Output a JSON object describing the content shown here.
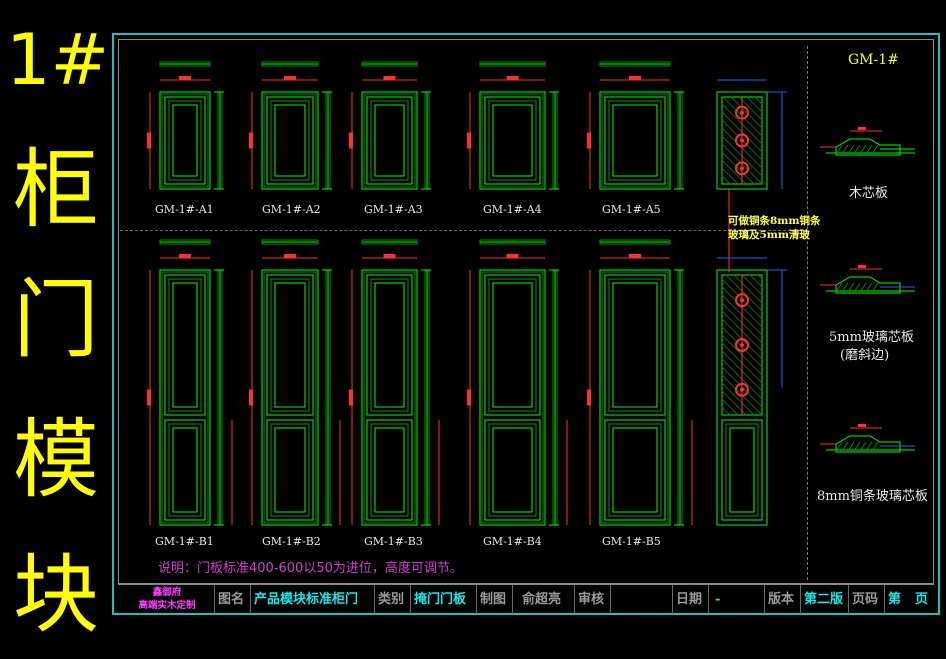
{
  "sidebar_title": [
    "1#",
    "柜",
    "门",
    "模",
    "块"
  ],
  "header": {
    "code": "GM-1#"
  },
  "doors_top": [
    "GM-1#-A1",
    "GM-1#-A2",
    "GM-1#-A3",
    "GM-1#-A4",
    "GM-1#-A5"
  ],
  "doors_bottom": [
    "GM-1#-B1",
    "GM-1#-B2",
    "GM-1#-B3",
    "GM-1#-B4",
    "GM-1#-B5"
  ],
  "glass_note": [
    "可做铜条8mm铜条",
    "玻璃及5mm清玻"
  ],
  "profiles": {
    "p1": "木芯板",
    "p2_line1": "5mm玻璃芯板",
    "p2_line2": "(磨斜边)",
    "p3": "8mm铜条玻璃芯板"
  },
  "note": "说明：门板标准400-600以50为进位，高度可调节。",
  "title_block": {
    "logo_line1": "鑫御府",
    "logo_line2": "高端实木定制",
    "name_label": "图名",
    "name_value": "产品模块标准柜门",
    "category_label": "类别",
    "category_value": "掩门门板",
    "drawn_label": "制图",
    "drawn_value": "俞超亮",
    "review_label": "审核",
    "date_label": "日期",
    "date_value": "-",
    "version_label": "版本",
    "version_value": "第二版",
    "page_label": "页码",
    "page_value": "第",
    "page_suffix": "页"
  },
  "colors": {
    "title": "#ffff00",
    "frame": "#1fbfbf",
    "line": "#00ff00",
    "dim": "#ff3030",
    "label": "#e8e8e8",
    "note": "#d040d0",
    "tb_label": "#9a9a9a",
    "tb_value": "#18e8e8"
  }
}
